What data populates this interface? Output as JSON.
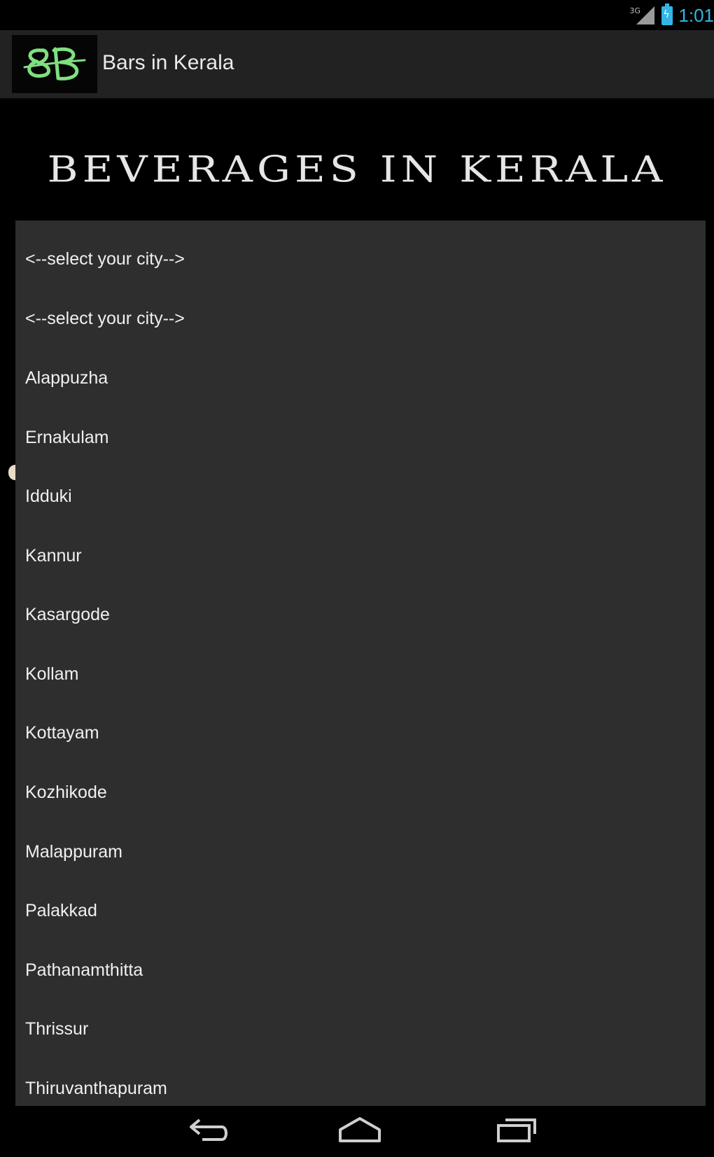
{
  "status_bar": {
    "network_type": "3G",
    "time": "1:01",
    "signal_icon": "signal-icon",
    "battery_icon": "battery-charging-icon"
  },
  "action_bar": {
    "logo_text": "BB",
    "title": "Bars in Kerala",
    "logo_color": "#7fe07f"
  },
  "banner": {
    "text": "BEVERAGES IN KERALA"
  },
  "dropdown": {
    "selected": "<--select your city-->",
    "options": [
      "<--select your city-->",
      "Alappuzha",
      "Ernakulam",
      "Idduki",
      "Kannur",
      "Kasargode",
      "Kollam",
      "Kottayam",
      "Kozhikode",
      "Malappuram",
      "Palakkad",
      "Pathanamthitta",
      "Thrissur",
      "Thiruvanthapuram"
    ]
  },
  "nav_bar": {
    "back_icon": "back-icon",
    "home_icon": "home-icon",
    "recents_icon": "recents-icon"
  },
  "colors": {
    "accent": "#33b5e5",
    "list_background": "#2e2e2e",
    "action_bar_background": "#222222"
  }
}
